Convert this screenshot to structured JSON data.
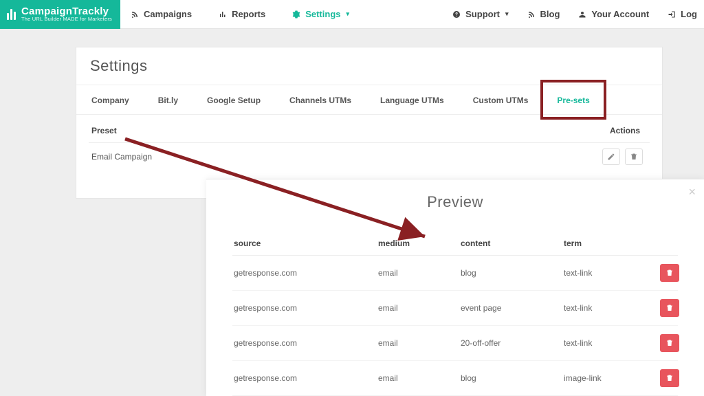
{
  "brand": {
    "name": "CampaignTrackly",
    "tagline": "The URL Builder MADE for Marketers"
  },
  "nav_left": [
    {
      "label": "Campaigns"
    },
    {
      "label": "Reports"
    },
    {
      "label": "Settings",
      "active": true,
      "caret": true
    }
  ],
  "nav_right": [
    {
      "label": "Support",
      "caret": true
    },
    {
      "label": "Blog"
    },
    {
      "label": "Your Account"
    },
    {
      "label": "Log"
    }
  ],
  "page_title": "Settings",
  "tabs": [
    {
      "label": "Company"
    },
    {
      "label": "Bit.ly"
    },
    {
      "label": "Google Setup"
    },
    {
      "label": "Channels UTMs"
    },
    {
      "label": "Language UTMs"
    },
    {
      "label": "Custom UTMs"
    },
    {
      "label": "Pre-sets",
      "active": true
    }
  ],
  "preset_table": {
    "head": {
      "name": "Preset",
      "actions": "Actions"
    },
    "rows": [
      {
        "name": "Email Campaign"
      }
    ]
  },
  "preview": {
    "title": "Preview",
    "head": {
      "source": "source",
      "medium": "medium",
      "content": "content",
      "term": "term"
    },
    "rows": [
      {
        "source": "getresponse.com",
        "medium": "email",
        "content": "blog",
        "term": "text-link"
      },
      {
        "source": "getresponse.com",
        "medium": "email",
        "content": "event page",
        "term": "text-link"
      },
      {
        "source": "getresponse.com",
        "medium": "email",
        "content": "20-off-offer",
        "term": "text-link"
      },
      {
        "source": "getresponse.com",
        "medium": "email",
        "content": "blog",
        "term": "image-link"
      }
    ]
  }
}
